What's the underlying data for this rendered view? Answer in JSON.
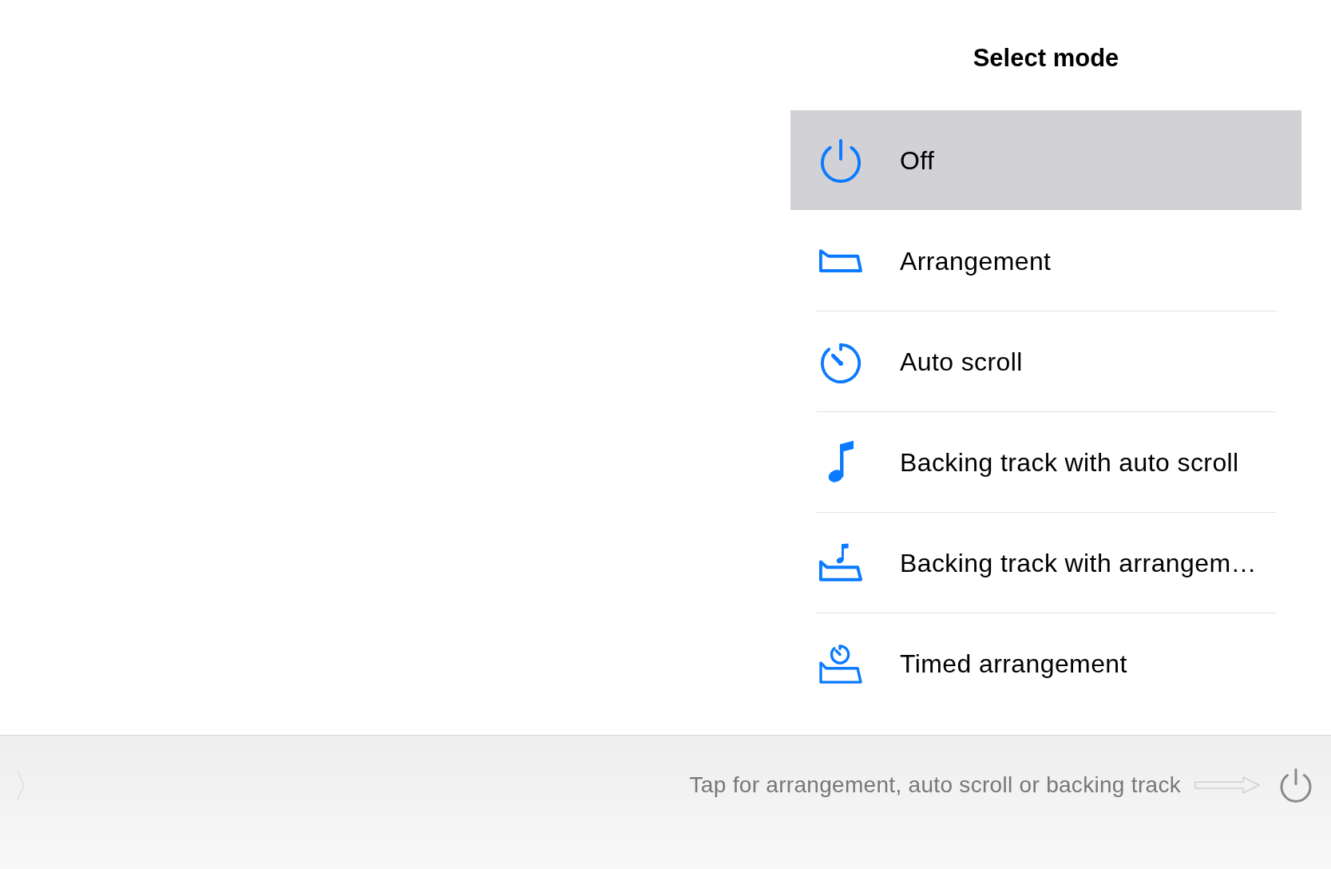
{
  "title": "Select mode",
  "modes": [
    {
      "label": "Off",
      "kind": "power",
      "selected": true
    },
    {
      "label": "Arrangement",
      "kind": "arrangement",
      "selected": false
    },
    {
      "label": "Auto scroll",
      "kind": "timer",
      "selected": false
    },
    {
      "label": "Backing track with auto scroll",
      "kind": "note",
      "selected": false
    },
    {
      "label": "Backing track with arrangem…",
      "kind": "note-arrangement",
      "selected": false
    },
    {
      "label": "Timed arrangement",
      "kind": "timer-arrangement",
      "selected": false
    }
  ],
  "footer": {
    "hint": "Tap for arrangement, auto scroll or backing track"
  }
}
